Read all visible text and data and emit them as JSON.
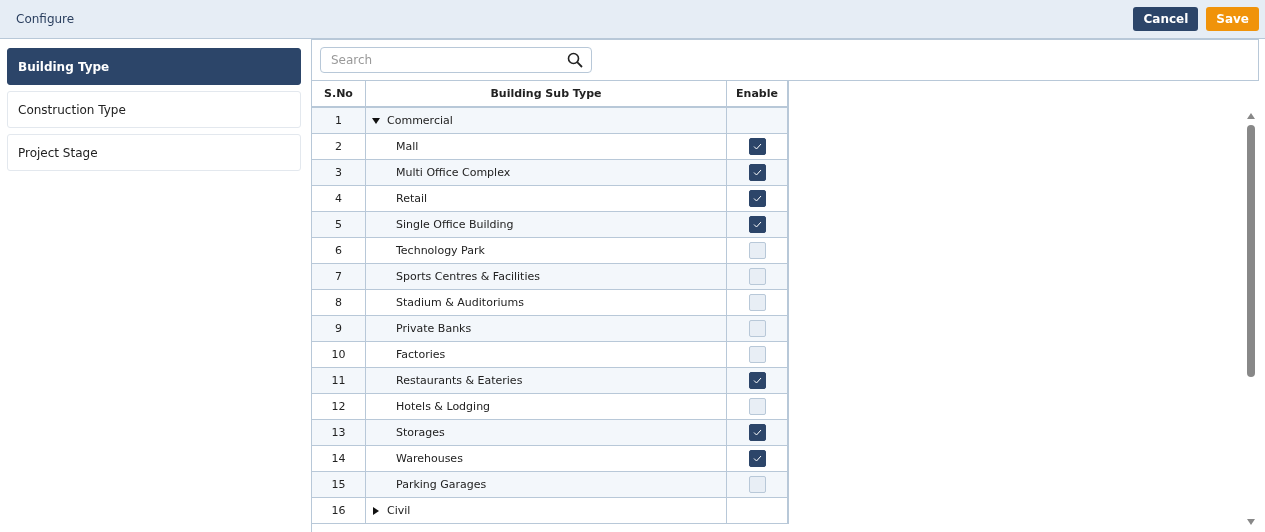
{
  "header": {
    "title": "Configure",
    "buttons": [
      {
        "label": "Cancel",
        "kind": "secondary"
      },
      {
        "label": "Save",
        "kind": "primary"
      }
    ]
  },
  "sidebar": {
    "items": [
      {
        "label": "Building Type",
        "selected": true
      },
      {
        "label": "Construction Type",
        "selected": false
      },
      {
        "label": "Project Stage",
        "selected": false
      }
    ]
  },
  "search": {
    "placeholder": "Search"
  },
  "table": {
    "columns": [
      "S.No",
      "Building Sub Type",
      "Enable"
    ],
    "rows": [
      {
        "kind": "group",
        "sno": "1",
        "name": "Commercial",
        "expanded": true
      },
      {
        "kind": "item",
        "sno": "2",
        "name": "Mall",
        "checked": true
      },
      {
        "kind": "item",
        "sno": "3",
        "name": "Multi Office Complex",
        "checked": true
      },
      {
        "kind": "item",
        "sno": "4",
        "name": "Retail",
        "checked": true
      },
      {
        "kind": "item",
        "sno": "5",
        "name": "Single Office Building",
        "checked": true
      },
      {
        "kind": "item",
        "sno": "6",
        "name": "Technology Park",
        "checked": false
      },
      {
        "kind": "item",
        "sno": "7",
        "name": "Sports Centres & Facilities",
        "checked": false
      },
      {
        "kind": "item",
        "sno": "8",
        "name": "Stadium & Auditoriums",
        "checked": false
      },
      {
        "kind": "item",
        "sno": "9",
        "name": "Private Banks",
        "checked": false
      },
      {
        "kind": "item",
        "sno": "10",
        "name": "Factories",
        "checked": false
      },
      {
        "kind": "item",
        "sno": "11",
        "name": "Restaurants & Eateries",
        "checked": true
      },
      {
        "kind": "item",
        "sno": "12",
        "name": "Hotels & Lodging",
        "checked": false
      },
      {
        "kind": "item",
        "sno": "13",
        "name": "Storages",
        "checked": true
      },
      {
        "kind": "item",
        "sno": "14",
        "name": "Warehouses",
        "checked": true
      },
      {
        "kind": "item",
        "sno": "15",
        "name": "Parking Garages",
        "checked": false
      },
      {
        "kind": "group",
        "sno": "16",
        "name": "Civil",
        "expanded": false
      }
    ]
  }
}
